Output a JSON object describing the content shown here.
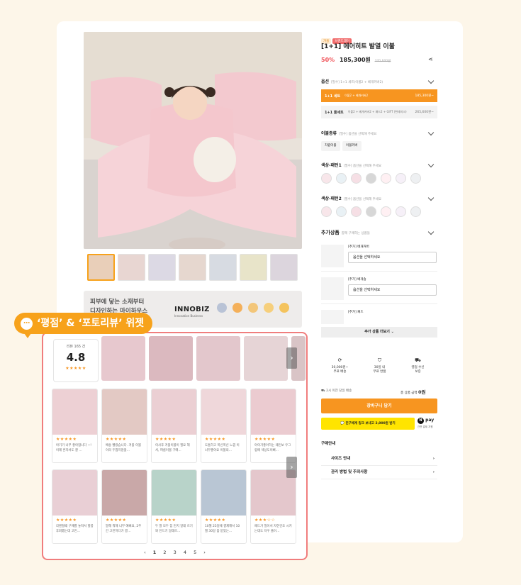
{
  "product": {
    "tags": [
      "가을",
      "브랜드데이"
    ],
    "title": "[1+1] 에어히트 발열 이불",
    "discount": "50%",
    "price": "185,300원",
    "original_price": "370,600원",
    "share_icon": "share-icon"
  },
  "banner": {
    "line1": "피부에 닿는 소재부터",
    "line2": "디자인하는 마이하우스",
    "logo": "INNOBIZ",
    "logo_sub": "Innovation Business"
  },
  "options": {
    "label": "옵션",
    "hint": "[필수] 1+1 세트(이불2 + 베개커버2)",
    "items": [
      {
        "name": "1+1 세트",
        "desc": "이불2 + 베개커버2",
        "price": "185,300원~"
      },
      {
        "name": "1+1 풀세트",
        "desc": "이불2 + 베개커버2 + 패드2 + GIFT (편레미크)",
        "price": "265,600원~"
      }
    ]
  },
  "blanket_type": {
    "label": "이불종류",
    "hint": "[필수] 옵션을 선택해 주세요",
    "chips": [
      "차렵이불",
      "이불커버"
    ]
  },
  "color1": {
    "label": "색상-패턴1",
    "hint": "[필수] 옵션을 선택해 주세요"
  },
  "color2": {
    "label": "색상-패턴2",
    "hint": "[필수] 옵션을 선택해 주세요"
  },
  "addons": {
    "label": "추가상품",
    "hint": "함께 구매하는 상품들",
    "items": [
      {
        "name": "[추가] 베개커버",
        "select": "옵션을 선택하세요"
      },
      {
        "name": "[추가] 베개솜",
        "select": "옵션을 선택하세요"
      },
      {
        "name": "[추가] 패드",
        "select": ""
      }
    ],
    "more": "추가 상품 더보기"
  },
  "services": [
    {
      "icon": "refresh-icon",
      "line1": "30,000원~",
      "line2": "무료 배송"
    },
    {
      "icon": "shield-icon",
      "line1": "30일 내",
      "line2": "무료 반품"
    },
    {
      "icon": "truck-icon",
      "line1": "영업 수신",
      "line2": "보증"
    }
  ],
  "delivery_note": "2시 이전 당일 배송",
  "total": {
    "label": "총 상품 금액",
    "value": "0원"
  },
  "buttons": {
    "cart": "장바구니 담기",
    "kakao": "친구에게 링크 보내고 2,000원 받기",
    "npay": "pay",
    "npay_sub": "간편 결제 지원"
  },
  "purchase_info": {
    "label": "구매안내",
    "rows": [
      "사이즈 안내",
      "관리 방법 및 주의사항"
    ]
  },
  "widget": {
    "callout": "‘평점’ & ‘포토리뷰’ 위젯",
    "rating_label": "리뷰 165 건",
    "rating_value": "4.8",
    "stars": "★★★★★",
    "reviews_row1": [
      {
        "stars": "★★★★★",
        "text": "아기가 너무 좋아합니다 ~! 이제 혼자서도 잘 ..."
      },
      {
        "stars": "★★★★★",
        "text": "배송 빨랐습니다. 겨울 이불이라 두껍지않을..."
      },
      {
        "stars": "★★★★★",
        "text": "이사후 겨울이불이 필요 해서, 여름이불 구매..."
      },
      {
        "stars": "★★★★★",
        "text": "도톰하고 폭신폭신 느낌 이 너무좋아요 이불의..."
      },
      {
        "stars": "★★★★★",
        "text": "아이가좋아하는 레인보 우그림에 색상도이뻐..."
      }
    ],
    "reviews_row2": [
      {
        "stars": "★★★★★",
        "text": "라벤할때 구매를 놓쳐서 할봉후회했는데 고민..."
      },
      {
        "stars": "★★★★★",
        "text": "말해 뭐해 너무 예뻐요, 2주간 고민하다가 결..."
      },
      {
        "stars": "★★★★★",
        "text": "두 딸 모두 집 먼지 알레 르기와 진드기 알레르..."
      },
      {
        "stars": "★★★★★",
        "text": "10월 25일에 결제해서 10월 30일 좀 받았는..."
      },
      {
        "stars": "★★★☆☆",
        "text": "패드가 밀어서 자연건조 시키는데도 자꾸 줄어..."
      }
    ],
    "pages": [
      "‹",
      "1",
      "2",
      "3",
      "4",
      "5",
      "›"
    ]
  },
  "colors": {
    "accent": "#f79520",
    "callout": "#f7a21b",
    "widget_border": "#f07d7d",
    "kakao": "#ffe400"
  }
}
